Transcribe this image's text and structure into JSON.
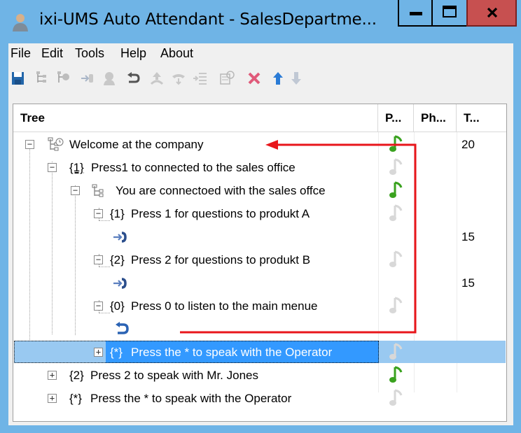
{
  "window": {
    "title": "ixi-UMS Auto Attendant - SalesDepartme...",
    "min_label": "minimize",
    "colors": {
      "titlebar": "#6fb4e6",
      "close": "#c75050",
      "selection": "#3399ff",
      "note_green": "#3aa21f",
      "note_grey": "#d8d8d8",
      "arrow": "#e8161b"
    }
  },
  "menu": {
    "file": "File",
    "edit": "Edit",
    "tools": "Tools",
    "help": "Help",
    "about": "About"
  },
  "toolbar": {
    "icons": [
      "save-icon",
      "tree-add-icon",
      "tree-node-icon",
      "forward-icon",
      "operator-icon",
      "back-icon",
      "up-level-icon",
      "phone-icon",
      "menu-add-icon",
      "properties-icon",
      "delete-icon",
      "move-up-icon",
      "move-down-icon"
    ]
  },
  "tree": {
    "headers": {
      "tree": "Tree",
      "p": "P...",
      "ph": "Ph...",
      "t": "T..."
    },
    "rows": [
      {
        "key": "",
        "label": "Welcome at the company",
        "t": "20",
        "note": "green"
      },
      {
        "key": "{1}",
        "label": "Press1 to connected to the sales office",
        "t": "",
        "note": "grey"
      },
      {
        "key": "",
        "label": "You are connectoed with the sales offce",
        "t": "",
        "note": "green"
      },
      {
        "key": "{1}",
        "label": "Press 1 for questions to produkt A",
        "t": "",
        "note": "grey"
      },
      {
        "key": "",
        "label": "",
        "t": "15",
        "note": ""
      },
      {
        "key": "{2}",
        "label": "Press 2 for questions to produkt B",
        "t": "",
        "note": "grey"
      },
      {
        "key": "",
        "label": "",
        "t": "15",
        "note": ""
      },
      {
        "key": "{0}",
        "label": "Press 0 to listen to the main menue",
        "t": "",
        "note": "grey"
      },
      {
        "key": "",
        "label": "",
        "t": "",
        "note": ""
      },
      {
        "key": "{*}",
        "label": "Press the * to speak with the Operator",
        "t": "",
        "note": "grey"
      },
      {
        "key": "{2}",
        "label": "Press 2 to speak with Mr. Jones",
        "t": "",
        "note": "green"
      },
      {
        "key": "{*}",
        "label": "Press the * to speak with the Operator",
        "t": "",
        "note": "grey"
      }
    ]
  }
}
